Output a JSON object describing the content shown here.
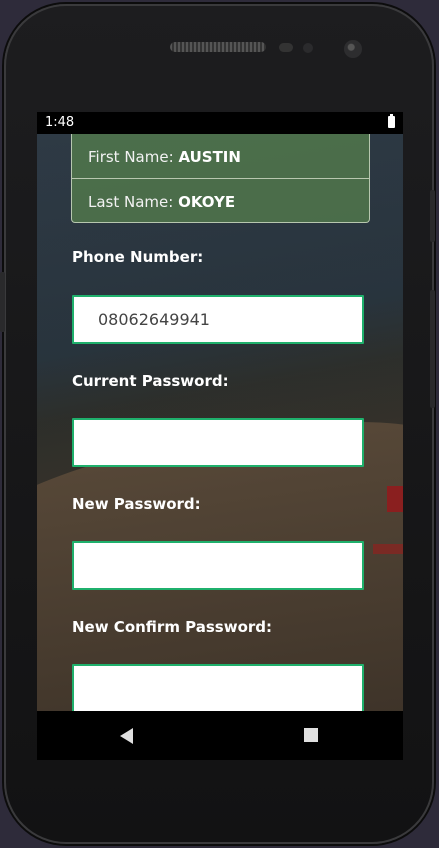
{
  "status": {
    "time": "1:48"
  },
  "profile": {
    "first_name_label": "First Name:",
    "first_name_value": "AUSTIN",
    "last_name_label": "Last Name:",
    "last_name_value": "OKOYE"
  },
  "form": {
    "phone_label": "Phone Number:",
    "phone_value": "08062649941",
    "current_password_label": "Current Password:",
    "current_password_value": "",
    "new_password_label": "New Password:",
    "new_password_value": "",
    "confirm_password_label": "New Confirm Password:",
    "confirm_password_value": ""
  },
  "colors": {
    "input_border": "#1fb06c",
    "name_card_bg": "#58824e"
  },
  "icons": {
    "status_battery": "battery-icon",
    "nav_back": "back-icon",
    "nav_recent": "recent-apps-icon"
  }
}
